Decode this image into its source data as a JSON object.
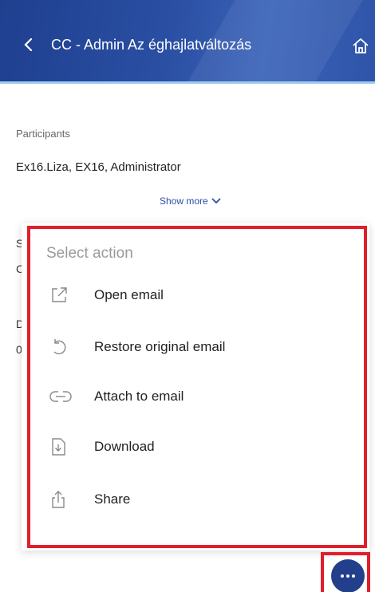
{
  "header": {
    "title": "CC - Admin Az éghajlatváltozás"
  },
  "details": {
    "participants_label": "Participants",
    "participants_value": "Ex16.Liza, EX16, Administrator",
    "show_more": "Show more",
    "partial_labels": [
      "S",
      "C",
      "D",
      "0"
    ]
  },
  "menu": {
    "title": "Select action",
    "items": [
      {
        "label": "Open email",
        "icon": "open-external-icon"
      },
      {
        "label": "Restore original email",
        "icon": "restore-icon"
      },
      {
        "label": "Attach to email",
        "icon": "link-icon"
      },
      {
        "label": "Download",
        "icon": "download-file-icon"
      },
      {
        "label": "Share",
        "icon": "share-icon"
      }
    ]
  },
  "colors": {
    "header": "#2a4fa3",
    "highlight": "#e01f2b",
    "fab": "#223f8c"
  }
}
